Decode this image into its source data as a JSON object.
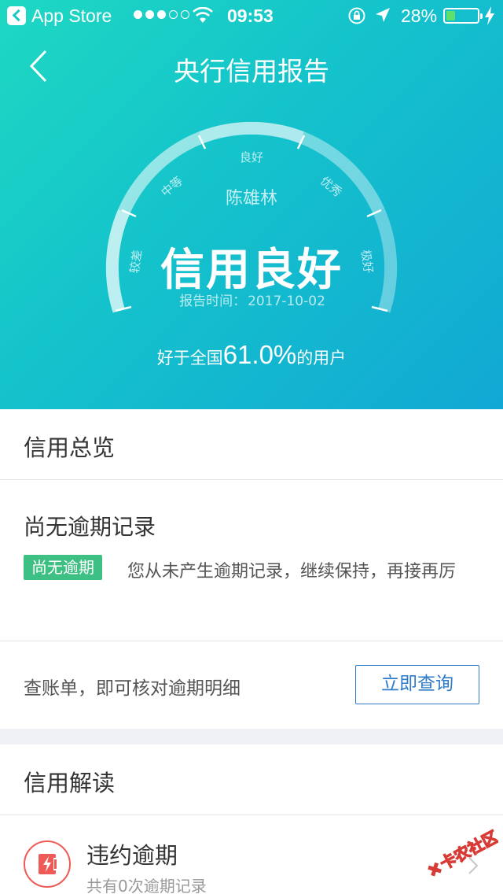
{
  "status_bar": {
    "app": "App Store",
    "time": "09:53",
    "battery": "28%",
    "battery_level": 0.28,
    "signal_bars_filled": 3,
    "signal_bars_total": 5
  },
  "header": {
    "title": "央行信用报告"
  },
  "gauge": {
    "segments": [
      "较差",
      "中等",
      "良好",
      "优秀",
      "极好"
    ],
    "name": "陈雄林",
    "status": "信用良好",
    "date_label": "报告时间：",
    "date_value": "2017-10-02",
    "rank_prefix": "好于全国",
    "rank_value": "61.0%",
    "rank_suffix": "的用户"
  },
  "overview": {
    "title": "信用总览",
    "overdue_title": "尚无逾期记录",
    "tag": "尚无逾期",
    "description": "您从未产生逾期记录，继续保持，再接再厉",
    "check_text": "查账单，即可核对逾期明细",
    "query_button": "立即查询"
  },
  "interpretation": {
    "title": "信用解读",
    "items": [
      {
        "title": "违约逾期",
        "subtitle": "共有0次逾期记录",
        "icon": "overdue-card-icon"
      }
    ]
  },
  "watermark": "卡农社区",
  "colors": {
    "accent": "#2f7bc9",
    "tag": "#3ebf83",
    "danger": "#ee5a55"
  }
}
